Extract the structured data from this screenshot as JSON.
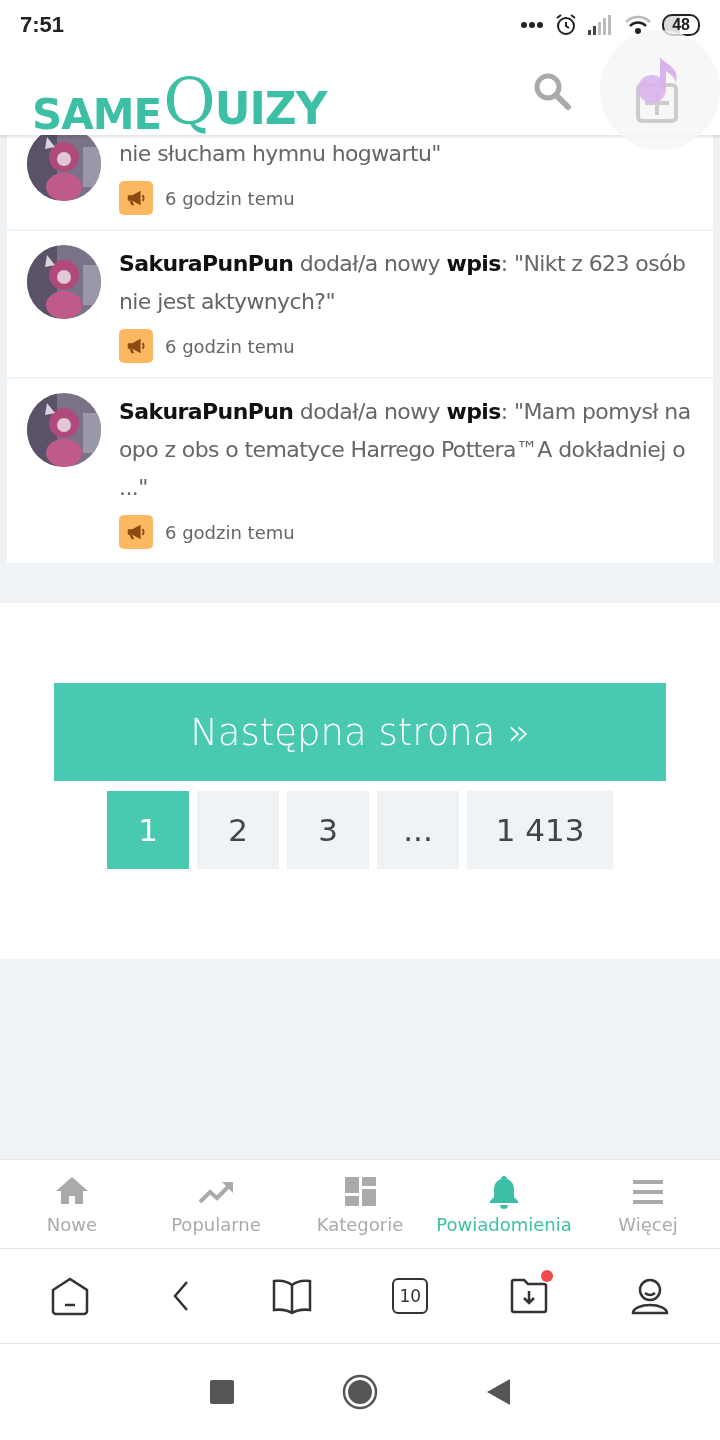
{
  "status_bar": {
    "time": "7:51",
    "battery": "48"
  },
  "header": {
    "logo": [
      "SAME",
      "QUIZY"
    ]
  },
  "feed": [
    {
      "kind": "partial",
      "text": "nie słucham hymnu hogwartu\"",
      "time": "6 godzin temu"
    },
    {
      "kind": "full",
      "text": "**SakuraPunPun** dodał/a nowy **wpis**: \"Nikt z 623 osób nie jest aktywnych?\"",
      "time": "6 godzin temu"
    },
    {
      "kind": "full",
      "text": "**SakuraPunPun** dodał/a nowy **wpis**: \"Mam pomysł na opo z obs o tematyce Harrego Pottera™A dokładniej o ...\"",
      "time": "6 godzin temu"
    }
  ],
  "next_button": "Następna strona »",
  "pages": [
    {
      "label": "1",
      "selected": true
    },
    {
      "label": "2",
      "selected": false
    },
    {
      "label": "3",
      "selected": false
    },
    {
      "label": "...",
      "selected": false
    },
    {
      "label": "1 413",
      "selected": false
    }
  ],
  "tabs": [
    {
      "label": "Nowe",
      "kind": "home",
      "selected": false
    },
    {
      "label": "Popularne",
      "kind": "trend",
      "selected": false
    },
    {
      "label": "Kategorie",
      "kind": "grid",
      "selected": false
    },
    {
      "label": "Powiadomienia",
      "kind": "bell",
      "selected": true
    },
    {
      "label": "Więcej",
      "kind": "menu",
      "selected": false
    }
  ],
  "browser": {
    "tab_count": "10",
    "download_badge": true
  }
}
